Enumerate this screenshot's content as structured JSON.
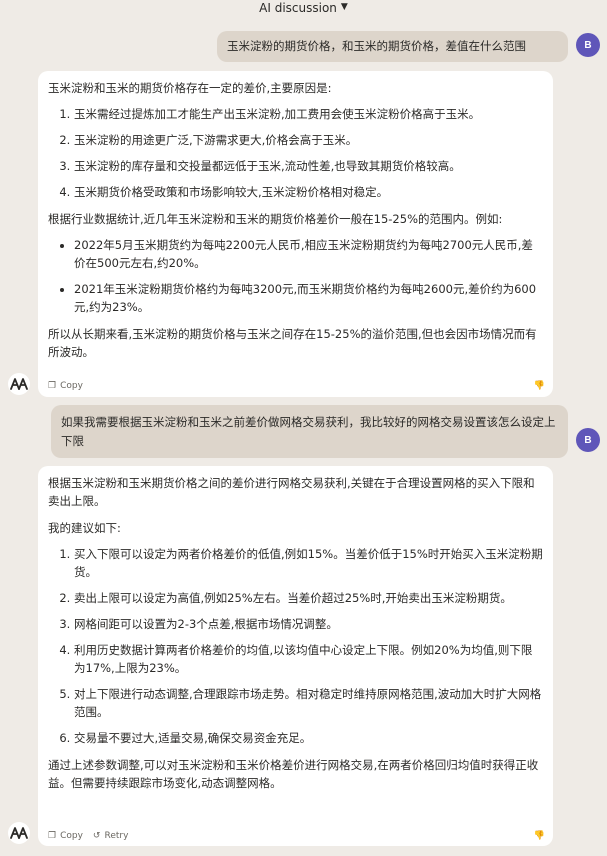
{
  "header": {
    "title": "AI discussion"
  },
  "user_avatar": "B",
  "messages": [
    {
      "role": "user",
      "text": "玉米淀粉的期货价格，和玉米的期货价格，差值在什么范围"
    },
    {
      "role": "assistant",
      "intro": "玉米淀粉和玉米的期货价格存在一定的差价,主要原因是:",
      "reasons": [
        "玉米需经过提炼加工才能生产出玉米淀粉,加工费用会使玉米淀粉价格高于玉米。",
        "玉米淀粉的用途更广泛,下游需求更大,价格会高于玉米。",
        "玉米淀粉的库存量和交投量都远低于玉米,流动性差,也导致其期货价格较高。",
        "玉米期货价格受政策和市场影响较大,玉米淀粉价格相对稳定。"
      ],
      "stats_intro": "根据行业数据统计,近几年玉米淀粉和玉米的期货价格差价一般在15-25%的范围内。例如:",
      "examples": [
        "2022年5月玉米期货约为每吨2200元人民币,相应玉米淀粉期货约为每吨2700元人民币,差价在500元左右,约20%。",
        "2021年玉米淀粉期货价格约为每吨3200元,而玉米期货价格约为每吨2600元,差价约为600元,约为23%。"
      ],
      "conclusion": "所以从长期来看,玉米淀粉的期货价格与玉米之间存在15-25%的溢价范围,但也会因市场情况而有所波动。",
      "actions": {
        "copy": "Copy"
      }
    },
    {
      "role": "user",
      "text": "如果我需要根据玉米淀粉和玉米之前差价做网格交易获利，我比较好的网格交易设置该怎么设定上下限"
    },
    {
      "role": "assistant",
      "intro": "根据玉米淀粉和玉米期货价格之间的差价进行网格交易获利,关键在于合理设置网格的买入下限和卖出上限。",
      "sub_intro": "我的建议如下:",
      "suggestions": [
        "买入下限可以设定为两者价格差价的低值,例如15%。当差价低于15%时开始买入玉米淀粉期货。",
        "卖出上限可以设定为高值,例如25%左右。当差价超过25%时,开始卖出玉米淀粉期货。",
        "网格间距可以设置为2-3个点差,根据市场情况调整。",
        "利用历史数据计算两者价格差价的均值,以该均值中心设定上下限。例如20%为均值,则下限为17%,上限为23%。",
        "对上下限进行动态调整,合理跟踪市场走势。相对稳定时维持原网格范围,波动加大时扩大网格范围。",
        "交易量不要过大,适量交易,确保交易资金充足。"
      ],
      "conclusion": "通过上述参数调整,可以对玉米淀粉和玉米价格差价进行网格交易,在两者价格回归均值时获得正收益。但需要持续跟踪市场变化,动态调整网格。",
      "actions": {
        "copy": "Copy",
        "retry": "Retry"
      }
    }
  ],
  "colors": {
    "background": "#efebe6",
    "user_bubble": "#ddd5cb",
    "avatar": "#5f56b9",
    "ai_bubble": "#ffffff"
  }
}
